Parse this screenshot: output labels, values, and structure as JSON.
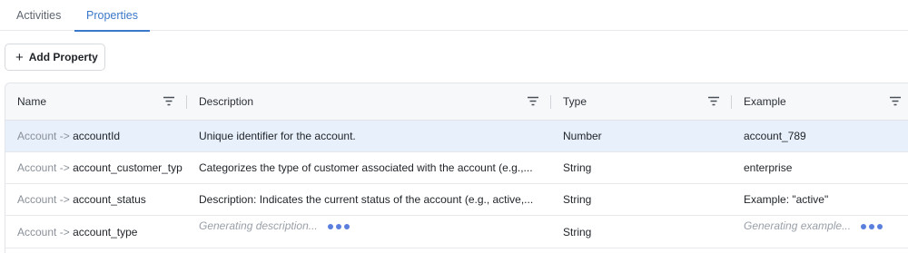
{
  "tabs": [
    {
      "label": "Activities",
      "active": false
    },
    {
      "label": "Properties",
      "active": true
    }
  ],
  "toolbar": {
    "add_label": "Add Property",
    "add_icon": "plus-icon"
  },
  "table": {
    "columns": [
      {
        "label": "Name"
      },
      {
        "label": "Description"
      },
      {
        "label": "Type"
      },
      {
        "label": "Example"
      }
    ],
    "rows": [
      {
        "parent": "Account",
        "arrow": "->",
        "name": "accountId",
        "description": "Unique identifier for the account.",
        "type": "Number",
        "example": "account_789",
        "selected": true
      },
      {
        "parent": "Account",
        "arrow": "->",
        "name": "account_customer_typ",
        "description": "Categorizes the type of customer associated with the account (e.g.,...",
        "type": "String",
        "example": "enterprise"
      },
      {
        "parent": "Account",
        "arrow": "->",
        "name": "account_status",
        "description": "Description: Indicates the current status of the account (e.g., active,...",
        "type": "String",
        "example": "Example: \"active\""
      },
      {
        "parent": "Account",
        "arrow": "->",
        "name": "account_type",
        "description": "Generating description...",
        "type": "String",
        "example": "Generating example...",
        "generating": true
      }
    ]
  },
  "colors": {
    "accent": "#3a78c9",
    "selected_row": "#e8f0fb",
    "loading_dots": "#5a7fdc"
  }
}
